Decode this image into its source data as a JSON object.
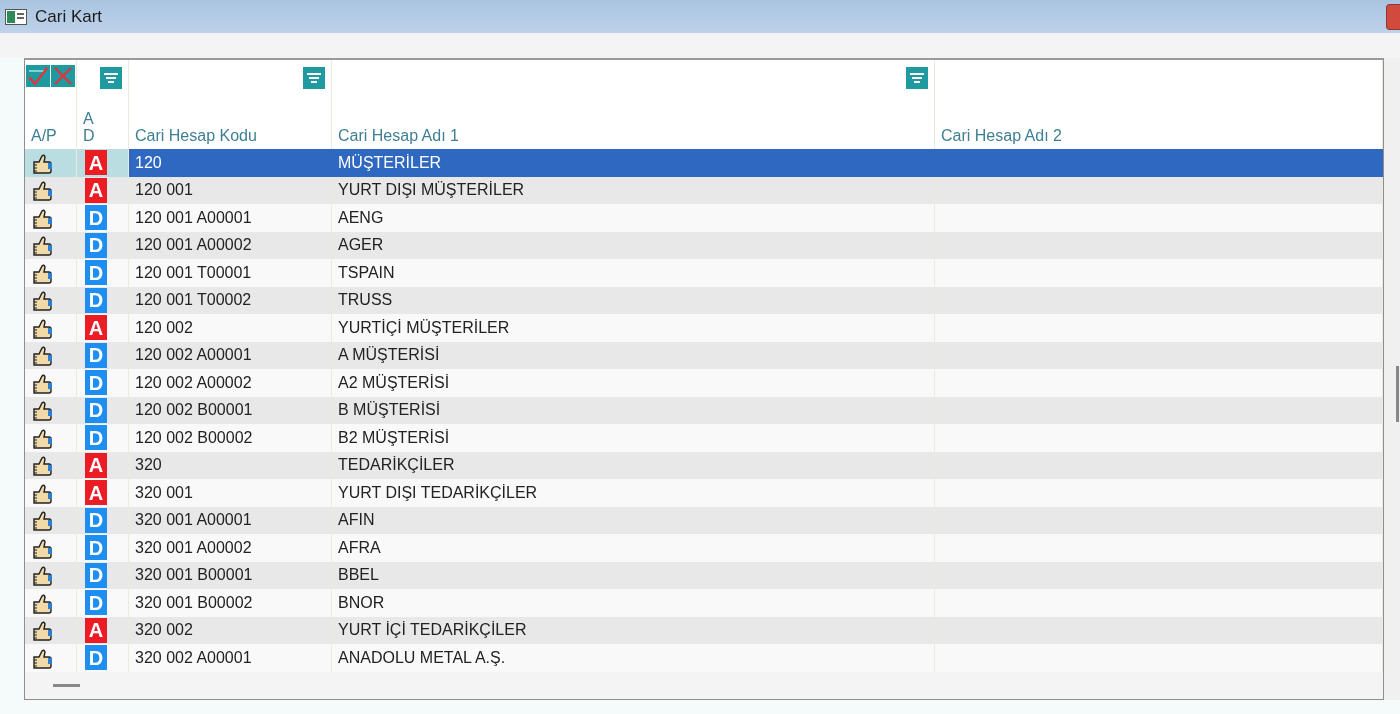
{
  "window": {
    "title": "Cari Kart"
  },
  "columns": [
    {
      "label": "A/P",
      "select_all": true,
      "filter": false
    },
    {
      "label": "A D",
      "select_all": false,
      "filter": true
    },
    {
      "label": "Cari Hesap Kodu",
      "select_all": false,
      "filter": true
    },
    {
      "label": "Cari Hesap Adı 1",
      "select_all": false,
      "filter": true
    },
    {
      "label": "Cari Hesap Adı 2",
      "select_all": false,
      "filter": false
    }
  ],
  "rows": [
    {
      "kind": "group",
      "type": "A",
      "code": "120",
      "name": "MÜŞTERİLER",
      "selected": true
    },
    {
      "kind": "group",
      "type": "A",
      "code": "120 001",
      "name": "YURT DIŞI MÜŞTERİLER",
      "selected": false
    },
    {
      "kind": "detail",
      "type": "D",
      "code": "120 001 A00001",
      "name": "AENG",
      "selected": false
    },
    {
      "kind": "detail",
      "type": "D",
      "code": "120 001 A00002",
      "name": "AGER",
      "selected": false
    },
    {
      "kind": "detail",
      "type": "D",
      "code": "120 001 T00001",
      "name": "TSPAIN",
      "selected": false
    },
    {
      "kind": "detail",
      "type": "D",
      "code": "120 001 T00002",
      "name": "TRUSS",
      "selected": false
    },
    {
      "kind": "group",
      "type": "A",
      "code": "120 002",
      "name": "YURTİÇİ MÜŞTERİLER",
      "selected": false
    },
    {
      "kind": "detail",
      "type": "D",
      "code": "120 002 A00001",
      "name": "A MÜŞTERİSİ",
      "selected": false
    },
    {
      "kind": "detail",
      "type": "D",
      "code": "120 002 A00002",
      "name": "A2 MÜŞTERİSİ",
      "selected": false
    },
    {
      "kind": "detail",
      "type": "D",
      "code": "120 002 B00001",
      "name": "B MÜŞTERİSİ",
      "selected": false
    },
    {
      "kind": "detail",
      "type": "D",
      "code": "120 002 B00002",
      "name": "B2 MÜŞTERİSİ",
      "selected": false
    },
    {
      "kind": "group",
      "type": "A",
      "code": "320",
      "name": "TEDARİKÇİLER",
      "selected": false
    },
    {
      "kind": "group",
      "type": "A",
      "code": "320 001",
      "name": "YURT DIŞI TEDARİKÇİLER",
      "selected": false
    },
    {
      "kind": "detail",
      "type": "D",
      "code": "320 001 A00001",
      "name": "AFIN",
      "selected": false
    },
    {
      "kind": "detail",
      "type": "D",
      "code": "320 001 A00002",
      "name": "AFRA",
      "selected": false
    },
    {
      "kind": "detail",
      "type": "D",
      "code": "320 001 B00001",
      "name": "BBEL",
      "selected": false
    },
    {
      "kind": "detail",
      "type": "D",
      "code": "320 001 B00002",
      "name": "BNOR",
      "selected": false
    },
    {
      "kind": "group",
      "type": "A",
      "code": "320 002",
      "name": "YURT İÇİ TEDARİKÇİLER",
      "selected": false
    },
    {
      "kind": "detail",
      "type": "D",
      "code": "320 002 A00001",
      "name": "ANADOLU METAL A.Ş.",
      "selected": false
    }
  ]
}
